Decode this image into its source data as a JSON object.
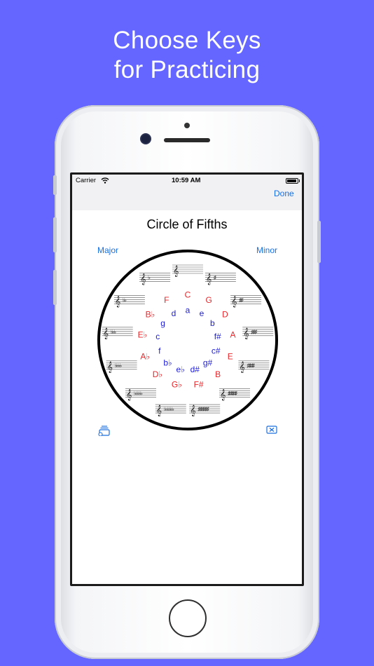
{
  "headline": {
    "line1": "Choose Keys",
    "line2": "for Practicing"
  },
  "status_bar": {
    "carrier": "Carrier",
    "time": "10:59 AM"
  },
  "nav": {
    "done_label": "Done"
  },
  "page": {
    "title": "Circle of Fifths"
  },
  "segments": {
    "major_label": "Major",
    "minor_label": "Minor"
  },
  "circle": {
    "major_keys": [
      "C",
      "G",
      "D",
      "A",
      "E",
      "B",
      "F#",
      "G♭",
      "D♭",
      "A♭",
      "E♭",
      "B♭",
      "F"
    ],
    "minor_keys": [
      "a",
      "e",
      "b",
      "f#",
      "c#",
      "g#",
      "d#",
      "e♭",
      "b♭",
      "f",
      "c",
      "g",
      "d"
    ],
    "major_color": "#e8262a",
    "minor_color": "#1c1bd6",
    "staves": [
      {
        "name": "C",
        "accidentals": ""
      },
      {
        "name": "G",
        "accidentals": "♯"
      },
      {
        "name": "D",
        "accidentals": "♯♯"
      },
      {
        "name": "A",
        "accidentals": "♯♯♯"
      },
      {
        "name": "E",
        "accidentals": "♯♯♯♯"
      },
      {
        "name": "B",
        "accidentals": "♯♯♯♯♯"
      },
      {
        "name": "F#",
        "accidentals": "♯♯♯♯♯♯"
      },
      {
        "name": "Gb",
        "accidentals": "♭♭♭♭♭♭"
      },
      {
        "name": "Db",
        "accidentals": "♭♭♭♭♭"
      },
      {
        "name": "Ab",
        "accidentals": "♭♭♭♭"
      },
      {
        "name": "Eb",
        "accidentals": "♭♭♭"
      },
      {
        "name": "Bb",
        "accidentals": "♭♭"
      },
      {
        "name": "F",
        "accidentals": "♭"
      }
    ]
  },
  "toolbar": {
    "left_icon": "stack-add-icon",
    "right_icon": "clear-icon"
  },
  "colors": {
    "background": "#6466ff",
    "accent": "#1a6fe0"
  }
}
